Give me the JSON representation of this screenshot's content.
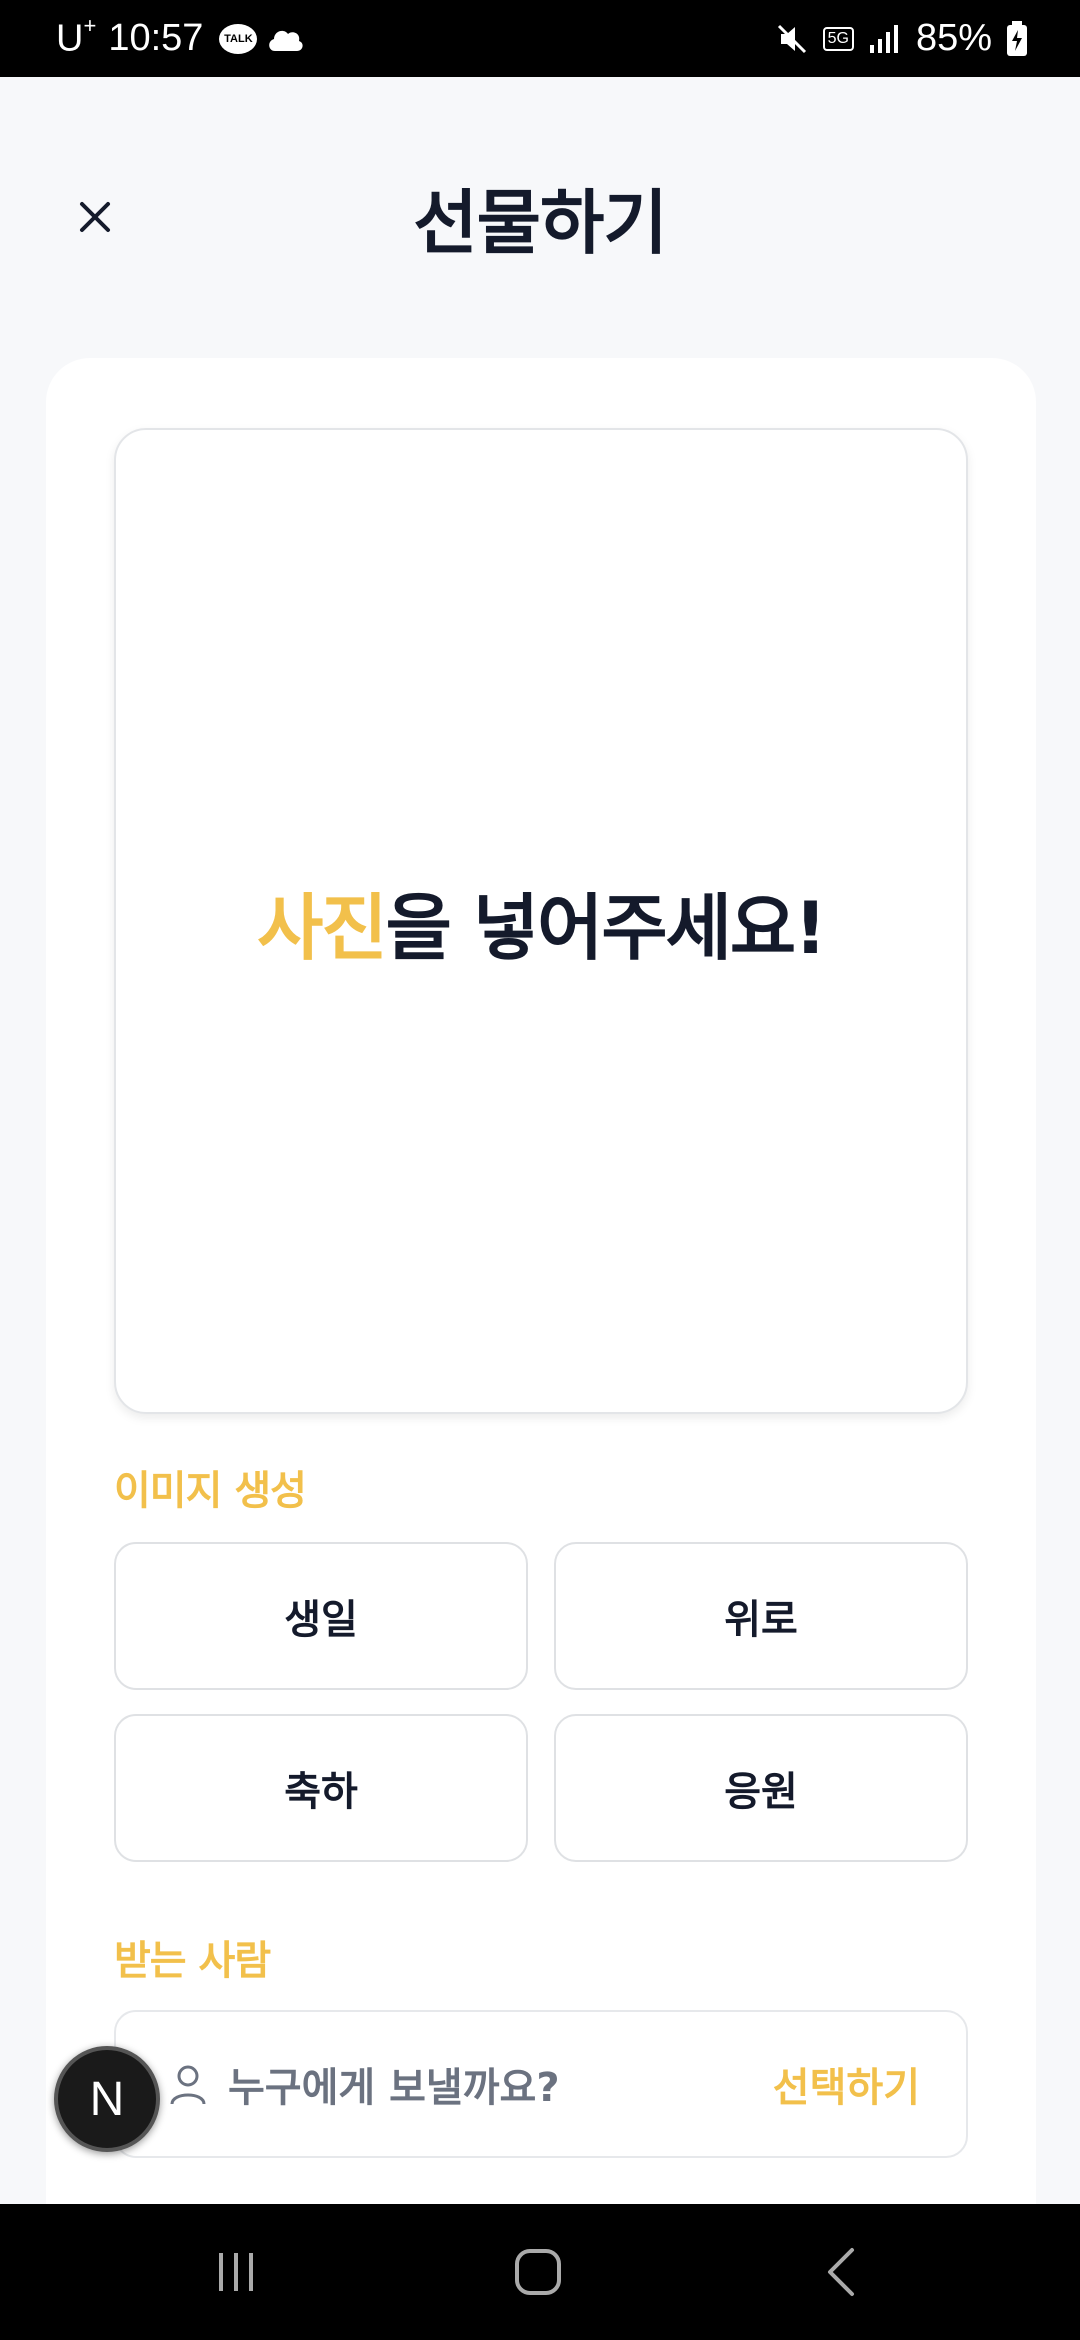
{
  "status_bar": {
    "carrier": "U",
    "carrier_sup": "+",
    "time": "10:57",
    "talk_badge": "TALK",
    "network": "5G",
    "battery": "85%"
  },
  "header": {
    "title": "선물하기",
    "close_icon": "close-icon"
  },
  "photo_upload": {
    "prompt_accent": "사진",
    "prompt_rest": "을 넣어주세요!"
  },
  "image_generation": {
    "label": "이미지 생성",
    "options": [
      "생일",
      "위로",
      "축하",
      "응원"
    ]
  },
  "recipient": {
    "label": "받는 사람",
    "placeholder": "누구에게 보낼까요?",
    "select_label": "선택하기"
  },
  "fab": {
    "label": "N"
  },
  "colors": {
    "accent": "#f2c04b",
    "text": "#141a2b",
    "background": "#f7f8fa"
  }
}
